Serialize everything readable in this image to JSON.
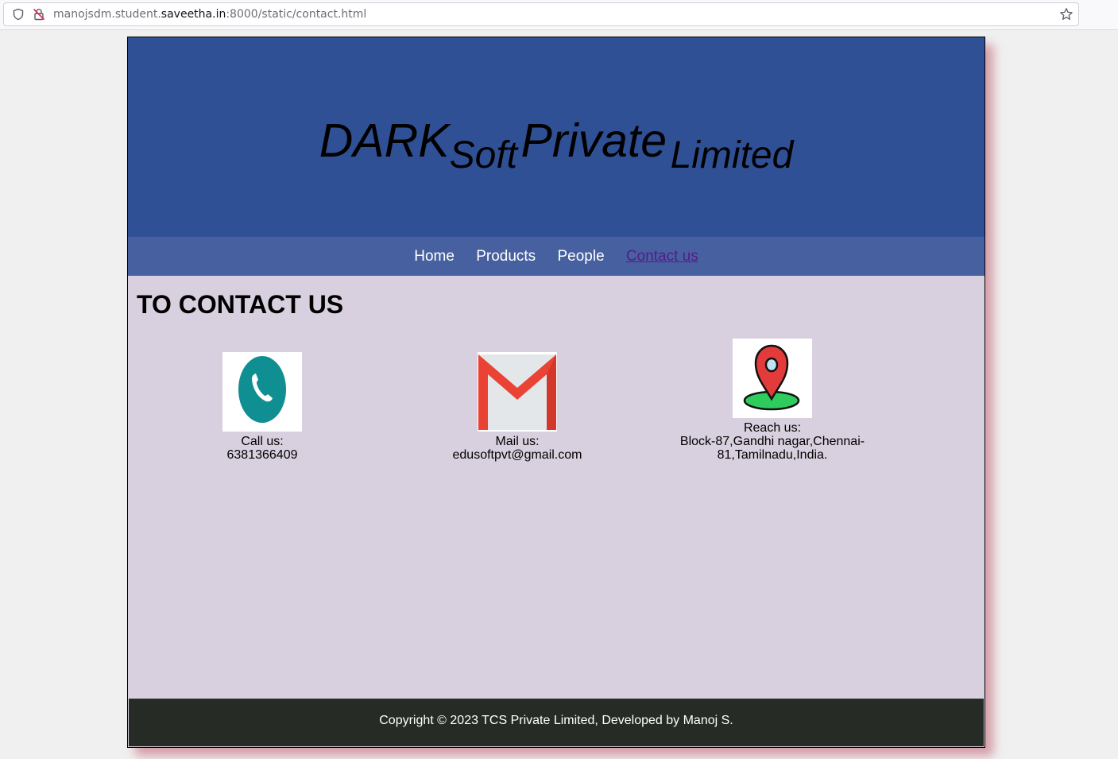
{
  "browser": {
    "url_prefix": "manojsdm.student.",
    "url_host": "saveetha.in",
    "url_suffix": ":8000/static/contact.html"
  },
  "header": {
    "brand_1": "DARK",
    "brand_2": "Soft",
    "brand_3": "Private",
    "brand_4": "Limited"
  },
  "nav": {
    "home": "Home",
    "products": "Products",
    "people": "People",
    "contact": "Contact us"
  },
  "main": {
    "title": "TO CONTACT US",
    "call_label": "Call us:",
    "call_value": "6381366409",
    "mail_label": "Mail us:",
    "mail_value": "edusoftpvt@gmail.com",
    "reach_label": "Reach us:",
    "reach_line1": "Block-87,Gandhi nagar,Chennai-",
    "reach_line2": "81,Tamilnadu,India."
  },
  "footer": {
    "text": "Copyright © 2023 TCS Private Limited, Developed by Manoj S."
  },
  "colors": {
    "banner": "#305096",
    "nav": "#4761a0",
    "content_bg": "#d8d0de",
    "footer": "#262c25",
    "active_link": "#551a8b"
  },
  "icons": [
    "shield-icon",
    "insecure-lock-icon",
    "bookmark-star-icon",
    "phone-icon",
    "gmail-icon",
    "location-pin-icon"
  ]
}
